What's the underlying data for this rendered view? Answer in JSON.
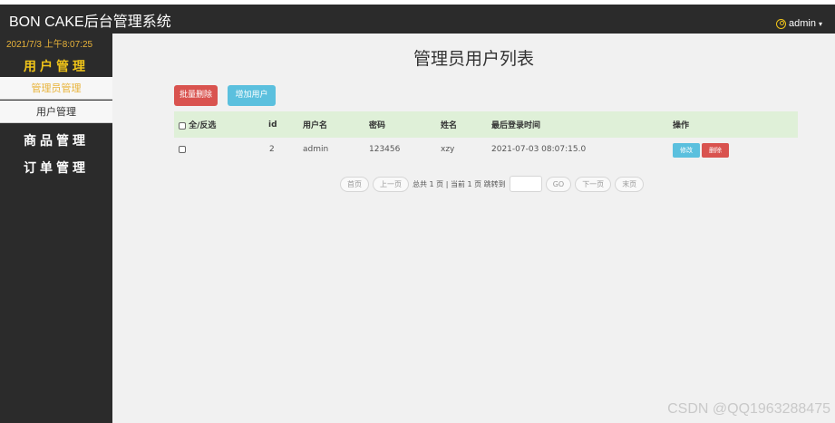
{
  "header": {
    "brand": "BON CAKE后台管理系统",
    "user": "admin"
  },
  "sidebar": {
    "clock": "2021/7/3 上午8:07:25",
    "sections": [
      {
        "label": "用户管理",
        "items": [
          "管理员管理",
          "用户管理"
        ]
      },
      {
        "label": "商品管理"
      },
      {
        "label": "订单管理"
      }
    ]
  },
  "main": {
    "title": "管理员用户列表",
    "batch_delete": "批量删除",
    "add_user": "增加用户",
    "table": {
      "select_all": "全/反选",
      "headers": [
        "id",
        "用户名",
        "密码",
        "姓名",
        "最后登录时间",
        "操作"
      ],
      "rows": [
        {
          "id": "2",
          "username": "admin",
          "password": "123456",
          "name": "xzy",
          "last_login": "2021-07-03 08:07:15.0",
          "edit": "修改",
          "delete": "删除"
        }
      ]
    },
    "pager": {
      "first": "首页",
      "prev": "上一页",
      "info": "总共 1 页 | 当前 1 页 跳转到",
      "go": "GO",
      "next": "下一页",
      "last": "末页"
    }
  },
  "watermark": "CSDN @QQ1963288475"
}
